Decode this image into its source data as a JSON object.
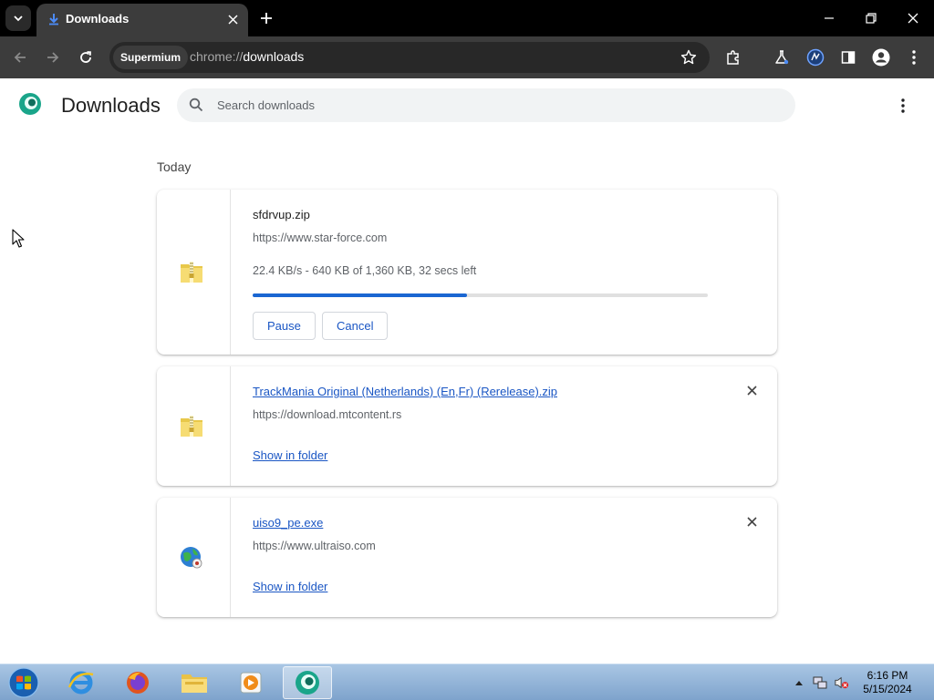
{
  "browser": {
    "tab_title": "Downloads",
    "chip_label": "Supermium",
    "url_scheme": "chrome://",
    "url_host": "downloads"
  },
  "page": {
    "title": "Downloads",
    "search_placeholder": "Search downloads",
    "section_label": "Today"
  },
  "downloads": [
    {
      "name": "sfdrvup.zip",
      "url": "https://www.star-force.com",
      "status": "22.4 KB/s - 640 KB of 1,360 KB, 32 secs left",
      "progress": 0.47,
      "pause_label": "Pause",
      "cancel_label": "Cancel",
      "icon": "zip-folder-icon"
    },
    {
      "name": "TrackMania Original (Netherlands) (En,Fr) (Rerelease).zip",
      "url": "https://download.mtcontent.rs",
      "action_label": "Show in folder",
      "icon": "zip-folder-icon"
    },
    {
      "name": "uiso9_pe.exe",
      "url": "https://www.ultraiso.com",
      "action_label": "Show in folder",
      "icon": "globe-installer-icon"
    }
  ],
  "taskbar": {
    "time": "6:16 PM",
    "date": "5/15/2024"
  },
  "colors": {
    "accent": "#1a66d2",
    "link": "#1a56c4",
    "titlebar": "#000000",
    "toolbar": "#3c3c3c"
  }
}
